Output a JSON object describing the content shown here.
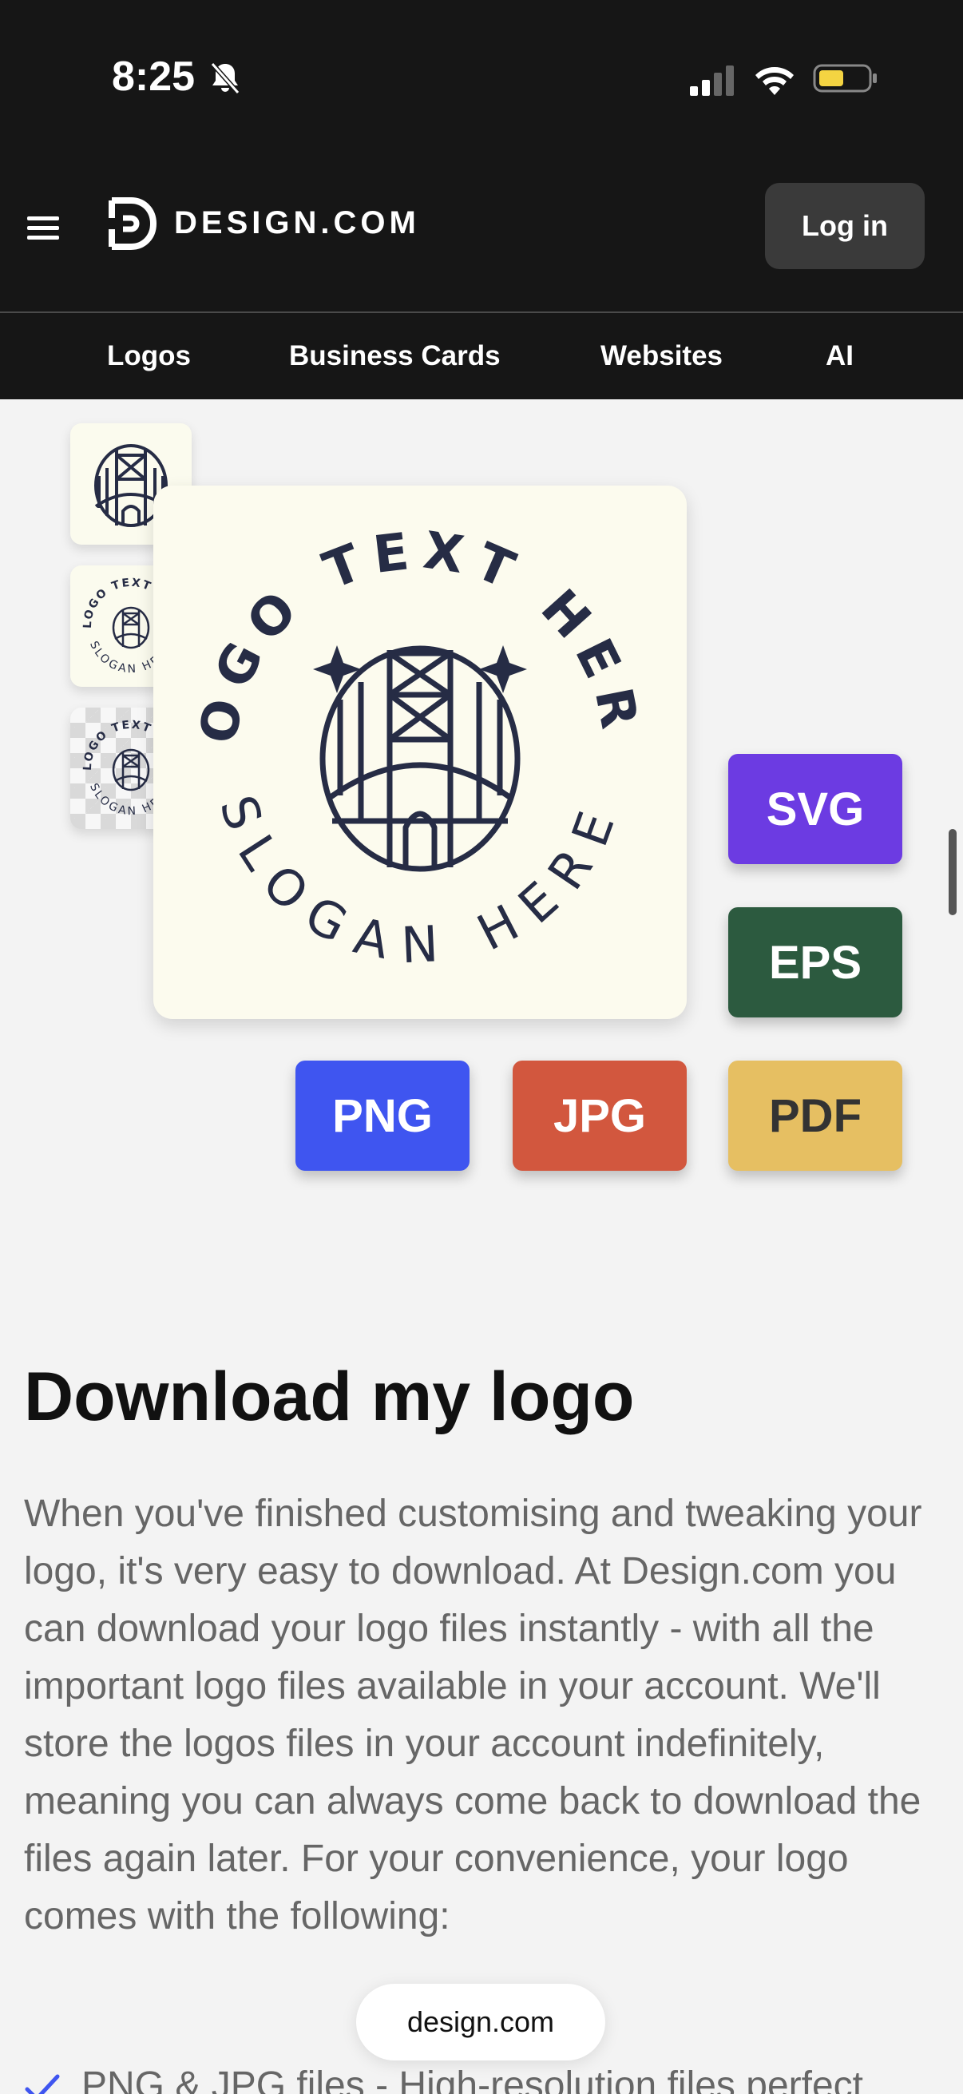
{
  "status_bar": {
    "time": "8:25",
    "icons": [
      "bell-slash-icon",
      "signal-icon",
      "wifi-icon",
      "battery-icon"
    ],
    "battery_color": "#f4d442"
  },
  "header": {
    "logo_text": "DESIGN.COM",
    "login_label": "Log in"
  },
  "nav": {
    "items": [
      {
        "label": "Logos"
      },
      {
        "label": "Business Cards"
      },
      {
        "label": "Websites"
      },
      {
        "label": "AI"
      }
    ]
  },
  "illustration": {
    "logo_text": "LOGO TEXT HERE",
    "slogan_text": "SLOGAN HERE",
    "formats": [
      {
        "label": "SVG",
        "color": "#6c3be2"
      },
      {
        "label": "EPS",
        "color": "#2c5a3f"
      },
      {
        "label": "PNG",
        "color": "#3f55f0"
      },
      {
        "label": "JPG",
        "color": "#d2573e"
      },
      {
        "label": "PDF",
        "color": "#e6bf62"
      }
    ]
  },
  "content": {
    "heading": "Download my logo",
    "paragraph": "When you've finished customising and tweaking your logo, it's very easy to download. At Design.com you can download your logo files instantly - with all the important logo files available in your account. We'll store the logos files in your account indefinitely, meaning you can always come back to download the files again later. For your convenience, your logo comes with the following:",
    "list": [
      {
        "text": "PNG & JPG files - High-resolution files perfect"
      }
    ]
  },
  "browser": {
    "url": "design.com"
  },
  "colors": {
    "dark_bar": "#161616",
    "brand_navy": "#262c45",
    "check_blue": "#3f55f0"
  }
}
